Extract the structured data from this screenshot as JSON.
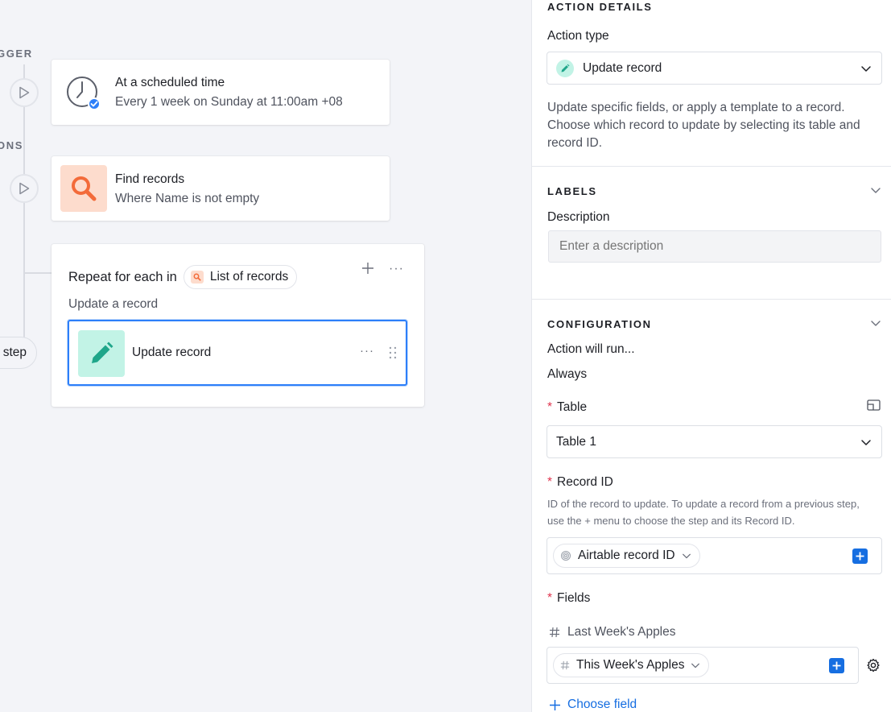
{
  "canvas": {
    "trigger_label": "GGER",
    "actions_label": "ONS",
    "trigger_card": {
      "title": "At a scheduled time",
      "subtitle": "Every 1 week on Sunday at 11:00am +08",
      "icon": "clock-icon"
    },
    "find_card": {
      "title": "Find records",
      "subtitle": "Where Name is not empty",
      "icon": "search-icon"
    },
    "repeat_card": {
      "title": "Repeat for each in",
      "list_chip": "List of records",
      "subtitle": "Update a record",
      "inner_step": {
        "title": "Update record",
        "icon": "pencil-icon"
      }
    },
    "step_pill": "step"
  },
  "panel": {
    "action_details": {
      "header": "ACTION DETAILS",
      "action_type_label": "Action type",
      "action_type_value": "Update record",
      "description": "Update specific fields, or apply a template to a record. Choose which record to update by selecting its table and record ID."
    },
    "labels": {
      "header": "LABELS",
      "description_label": "Description",
      "description_placeholder": "Enter a description"
    },
    "configuration": {
      "header": "CONFIGURATION",
      "run_label": "Action will run...",
      "run_value": "Always",
      "table_label": "Table",
      "table_value": "Table 1",
      "record_id_label": "Record ID",
      "record_id_help": "ID of the record to update. To update a record from a previous step, use the + menu to choose the step and its Record ID.",
      "record_id_token": "Airtable record ID",
      "fields_label": "Fields",
      "field_name": "Last Week's Apples",
      "field_token": "This Week's Apples",
      "choose_field": "Choose field"
    }
  },
  "colors": {
    "accent_blue": "#166ee1",
    "search_tile": "#fddccd",
    "search_icon": "#f36b3a",
    "pencil_tile": "#c2f3e6",
    "pencil_icon": "#1fa68a",
    "required": "#e0334d"
  }
}
